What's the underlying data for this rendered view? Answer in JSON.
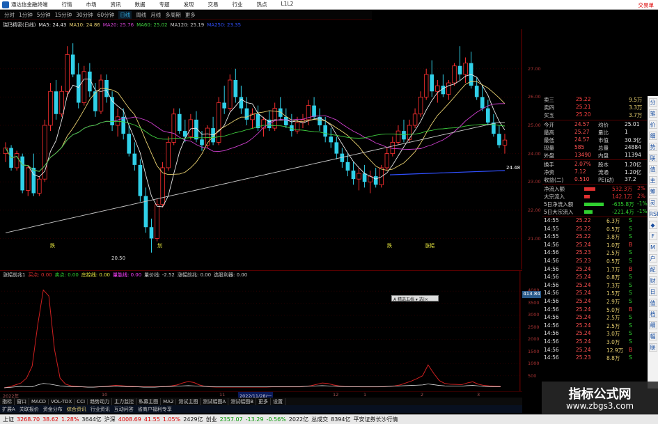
{
  "app": {
    "title": "通达信金融终端",
    "menu": [
      "行情",
      "市场",
      "资讯",
      "数据",
      "专题",
      "发现",
      "交易",
      "行业",
      "热点",
      "L1L2"
    ],
    "right_label": "交易单"
  },
  "period_tabs": {
    "items": [
      "分时",
      "1分钟",
      "5分钟",
      "15分钟",
      "30分钟",
      "60分钟",
      "日线",
      "周线",
      "月线",
      "多周期",
      "更多"
    ],
    "active": 6
  },
  "stock": {
    "name": "瑞玛精密(日线)"
  },
  "ma_legend": [
    {
      "label": "MA5: 24.43",
      "color": "#e8e8e8"
    },
    {
      "label": "MA10: 24.86",
      "color": "#e8d070"
    },
    {
      "label": "MA20: 25.76",
      "color": "#d040d0"
    },
    {
      "label": "MA60: 25.02",
      "color": "#40d040"
    },
    {
      "label": "MA120: 25.19",
      "color": "#c8c8c8"
    },
    {
      "label": "MA250: 23.35",
      "color": "#3050ff"
    }
  ],
  "indicator_legend": [
    {
      "label": "涨幅前兆1",
      "color": "#cccccc"
    },
    {
      "label": "买点: 0.00",
      "color": "#e03030"
    },
    {
      "label": "卖点: 0.00",
      "color": "#30d030"
    },
    {
      "label": "庄控线: 0.00",
      "color": "#e8e840"
    },
    {
      "label": "量能线: 0.00",
      "color": "#ff40ff"
    },
    {
      "label": "量价线: -2.52",
      "color": "#cccccc"
    },
    {
      "label": "涨幅前兆: 0.00",
      "color": "#cccccc"
    },
    {
      "label": "选股利器: 0.00",
      "color": "#cccccc"
    }
  ],
  "annotations": {
    "low_price": "20.50",
    "last_price": "24.48",
    "marks": [
      "跌",
      "划",
      "跌",
      "涨幅"
    ]
  },
  "y_axis_main": [
    "27.00",
    "26.00",
    "25.00",
    "24.00",
    "23.00",
    "22.00",
    "21.00"
  ],
  "y_axis_sub": [
    "4000",
    "3500",
    "3000",
    "2500",
    "2000",
    "1500",
    "1000",
    "500"
  ],
  "sub_price_tag": "413.84",
  "popup": "A 精选五档 ▾ 选|×",
  "time_axis": {
    "labels": [
      "2022年",
      "10",
      "11",
      "12",
      "2022/11/28/一",
      "1",
      "2",
      "3"
    ],
    "selected": 4
  },
  "bottom_tabs": [
    "指标",
    "窗口",
    "MACD",
    "VOL-TDX",
    "CCI",
    "趋势动力",
    "主力监控",
    "私募主图",
    "MA2",
    "测试主图",
    "测试幅图A",
    "测试幅图B",
    "更多",
    "设置"
  ],
  "news_tabs": [
    "扩展A",
    "关联报价",
    "资金分布",
    "综合资讯",
    "行业资讯",
    "互动问答",
    "省商户福利专享"
  ],
  "news_tabs_active": 3,
  "quote": {
    "book": [
      {
        "label": "卖三",
        "price": "25.22",
        "vol": "9.5万"
      },
      {
        "label": "卖四",
        "price": "25.21",
        "vol": "3.3万"
      },
      {
        "label": "买五",
        "price": "25.20",
        "vol": "3.7万"
      }
    ],
    "stats": [
      {
        "k1": "今开",
        "v1": "24.57",
        "k2": "均价",
        "v2": "25.01"
      },
      {
        "k1": "最高",
        "v1": "25.27",
        "k2": "量比",
        "v2": "1"
      },
      {
        "k1": "最低",
        "v1": "24.57",
        "k2": "市值",
        "v2": "30.3亿"
      },
      {
        "k1": "现量",
        "v1": "585",
        "k2": "总量",
        "v2": "24884"
      },
      {
        "k1": "外盘",
        "v1": "13490",
        "k2": "内盘",
        "v2": "11394"
      },
      {
        "k1": "换手",
        "v1": "2.07%",
        "k2": "股本",
        "v2": "1.20亿"
      },
      {
        "k1": "净资",
        "v1": "7.12",
        "k2": "流通",
        "v2": "1.20亿"
      },
      {
        "k1": "收益(二)",
        "v1": "0.510",
        "k2": "PE(动)",
        "v2": "37.2"
      }
    ],
    "flows": [
      {
        "label": "净流入额",
        "value": "532.3万",
        "pct": "2%",
        "color": "#e03030",
        "barlen": 8
      },
      {
        "label": "大宗流入",
        "value": "142.1万",
        "pct": "2%",
        "color": "#e03030",
        "barlen": 4
      },
      {
        "label": "5日净流入额",
        "value": "-635.8万",
        "pct": "-1%",
        "color": "#30d030",
        "barlen": 14
      },
      {
        "label": "5日大宗流入",
        "value": "-221.4万",
        "pct": "-1%",
        "color": "#30d030",
        "barlen": 6
      }
    ],
    "ticks": [
      {
        "time": "14:55",
        "price": "25.22",
        "vol": "6.3万",
        "side": "S"
      },
      {
        "time": "14:55",
        "price": "25.22",
        "vol": "0.5万",
        "side": "S"
      },
      {
        "time": "14:55",
        "price": "25.22",
        "vol": "3.8万",
        "side": "S"
      },
      {
        "time": "14:56",
        "price": "25.24",
        "vol": "1.0万",
        "side": "B"
      },
      {
        "time": "14:56",
        "price": "25.23",
        "vol": "2.5万",
        "side": "S"
      },
      {
        "time": "14:56",
        "price": "25.23",
        "vol": "0.5万",
        "side": "S"
      },
      {
        "time": "14:56",
        "price": "25.24",
        "vol": "1.7万",
        "side": "B"
      },
      {
        "time": "14:56",
        "price": "25.24",
        "vol": "0.8万",
        "side": "S"
      },
      {
        "time": "14:56",
        "price": "25.24",
        "vol": "7.3万",
        "side": "S"
      },
      {
        "time": "14:56",
        "price": "25.24",
        "vol": "1.5万",
        "side": "S"
      },
      {
        "time": "14:56",
        "price": "25.24",
        "vol": "2.9万",
        "side": "S"
      },
      {
        "time": "14:56",
        "price": "25.24",
        "vol": "5.0万",
        "side": "B"
      },
      {
        "time": "14:56",
        "price": "25.24",
        "vol": "2.5万",
        "side": "S"
      },
      {
        "time": "14:56",
        "price": "25.24",
        "vol": "2.5万",
        "side": "S"
      },
      {
        "time": "14:56",
        "price": "25.24",
        "vol": "3.0万",
        "side": "S"
      },
      {
        "time": "14:56",
        "price": "25.24",
        "vol": "3.0万",
        "side": "S"
      },
      {
        "time": "14:56",
        "price": "25.24",
        "vol": "12.9万",
        "side": "B"
      },
      {
        "time": "14:56",
        "price": "25.23",
        "vol": "8.8万",
        "side": "S"
      }
    ]
  },
  "side_toolbar": [
    "分",
    "笔",
    "价",
    "细",
    "势",
    "联",
    "值",
    "主",
    "筹",
    "灵",
    "RSI",
    "◆",
    "F",
    "M",
    "户",
    "配",
    "财",
    "日",
    "值",
    "档",
    "细",
    "幅",
    "联"
  ],
  "status": [
    {
      "text": "上证",
      "color": "#111"
    },
    {
      "text": "3268.70",
      "color": "#d00"
    },
    {
      "text": "38.62",
      "color": "#d00"
    },
    {
      "text": "1.28%",
      "color": "#d00"
    },
    {
      "text": "3644亿",
      "color": "#111"
    },
    {
      "text": "沪深",
      "color": "#111"
    },
    {
      "text": "4008.69",
      "color": "#d00"
    },
    {
      "text": "41.55",
      "color": "#d00"
    },
    {
      "text": "1.05%",
      "color": "#d00"
    },
    {
      "text": "2429亿",
      "color": "#111"
    },
    {
      "text": "创业",
      "color": "#111"
    },
    {
      "text": "2357.07",
      "color": "#090"
    },
    {
      "text": "-13.29",
      "color": "#090"
    },
    {
      "text": "-0.56%",
      "color": "#090"
    },
    {
      "text": "2022亿",
      "color": "#111"
    },
    {
      "text": "总成交",
      "color": "#111"
    },
    {
      "text": "8394亿",
      "color": "#111"
    },
    {
      "text": "平安证券长沙行情",
      "color": "#111"
    }
  ],
  "watermark": {
    "title": "指标公式网",
    "url": "www.zbgs3.com"
  },
  "colors": {
    "up": "#ff3030",
    "down": "#30d0e8",
    "ma5": "#e8e8e8",
    "ma10": "#e8d070",
    "ma20": "#d040d0",
    "ma60": "#40d040",
    "ma120": "#c8c8c8",
    "ma250": "#3050ff"
  },
  "chart_data": {
    "type": "candlestick",
    "note_series": "approximate daily OHLC read from chart",
    "ohlc": [
      [
        24.0,
        24.4,
        23.7,
        24.2
      ],
      [
        24.2,
        24.3,
        23.4,
        23.5
      ],
      [
        23.5,
        24.1,
        23.4,
        24.0
      ],
      [
        23.9,
        24.0,
        22.6,
        22.7
      ],
      [
        22.7,
        23.6,
        22.5,
        23.5
      ],
      [
        23.5,
        24.0,
        22.5,
        22.6
      ],
      [
        22.6,
        23.2,
        22.5,
        23.1
      ],
      [
        23.1,
        25.2,
        23.0,
        25.0
      ],
      [
        25.0,
        26.5,
        24.8,
        26.2
      ],
      [
        26.2,
        26.6,
        25.2,
        25.4
      ],
      [
        25.4,
        26.4,
        25.3,
        26.2
      ],
      [
        26.2,
        27.8,
        26.0,
        27.5
      ],
      [
        27.5,
        27.9,
        26.7,
        26.8
      ],
      [
        26.8,
        27.2,
        25.6,
        25.8
      ],
      [
        25.8,
        27.1,
        25.7,
        26.9
      ],
      [
        26.9,
        27.2,
        26.0,
        26.2
      ],
      [
        26.2,
        26.5,
        25.3,
        25.5
      ],
      [
        25.5,
        26.8,
        25.4,
        26.6
      ],
      [
        26.6,
        26.8,
        25.8,
        26.0
      ],
      [
        26.0,
        26.2,
        24.8,
        25.0
      ],
      [
        25.0,
        25.6,
        24.6,
        25.3
      ],
      [
        25.3,
        25.6,
        24.5,
        24.7
      ],
      [
        24.7,
        25.0,
        23.9,
        24.0
      ],
      [
        24.0,
        24.4,
        23.4,
        23.6
      ],
      [
        23.6,
        23.8,
        22.3,
        22.5
      ],
      [
        22.5,
        22.8,
        21.2,
        21.4
      ],
      [
        21.4,
        21.7,
        20.5,
        21.0
      ],
      [
        21.0,
        22.4,
        20.9,
        22.2
      ],
      [
        22.2,
        23.7,
        22.1,
        23.5
      ],
      [
        23.5,
        24.6,
        23.4,
        24.4
      ],
      [
        24.4,
        25.6,
        24.3,
        25.4
      ],
      [
        25.4,
        25.6,
        24.7,
        24.8
      ],
      [
        24.8,
        25.2,
        24.4,
        24.6
      ],
      [
        24.6,
        25.4,
        24.5,
        25.2
      ],
      [
        25.2,
        25.5,
        24.4,
        24.5
      ],
      [
        24.5,
        24.8,
        24.1,
        24.3
      ],
      [
        24.3,
        25.0,
        24.2,
        24.9
      ],
      [
        24.9,
        25.3,
        24.3,
        24.4
      ],
      [
        24.4,
        26.0,
        24.3,
        25.8
      ],
      [
        25.8,
        26.4,
        25.4,
        25.6
      ],
      [
        25.6,
        26.8,
        25.5,
        26.6
      ],
      [
        26.6,
        27.0,
        25.8,
        26.0
      ],
      [
        26.0,
        26.4,
        25.4,
        25.6
      ],
      [
        25.6,
        26.0,
        25.0,
        25.2
      ],
      [
        25.2,
        25.6,
        24.9,
        25.4
      ],
      [
        25.4,
        25.7,
        24.8,
        24.9
      ],
      [
        24.9,
        25.3,
        24.6,
        25.2
      ],
      [
        25.2,
        25.5,
        24.8,
        24.9
      ],
      [
        24.9,
        25.8,
        24.8,
        25.6
      ],
      [
        25.6,
        26.0,
        25.2,
        25.3
      ],
      [
        25.3,
        25.6,
        24.9,
        25.0
      ],
      [
        25.0,
        25.4,
        24.6,
        24.8
      ],
      [
        24.8,
        25.3,
        24.7,
        25.1
      ],
      [
        25.1,
        25.4,
        24.9,
        25.2
      ],
      [
        25.2,
        25.9,
        25.0,
        25.7
      ],
      [
        25.7,
        26.0,
        25.2,
        25.3
      ],
      [
        25.3,
        25.6,
        24.8,
        25.0
      ],
      [
        25.0,
        25.3,
        24.4,
        24.6
      ],
      [
        24.6,
        24.9,
        24.2,
        24.4
      ],
      [
        24.4,
        24.6,
        23.8,
        24.0
      ],
      [
        24.0,
        24.2,
        23.5,
        23.7
      ],
      [
        23.7,
        24.0,
        23.2,
        23.4
      ],
      [
        23.4,
        23.7,
        22.9,
        23.1
      ],
      [
        23.1,
        23.5,
        22.7,
        23.3
      ],
      [
        23.3,
        23.6,
        22.8,
        23.0
      ],
      [
        23.0,
        23.4,
        22.6,
        23.2
      ],
      [
        23.2,
        23.5,
        22.8,
        22.9
      ],
      [
        22.9,
        23.6,
        22.8,
        23.5
      ],
      [
        23.5,
        24.2,
        23.4,
        24.0
      ],
      [
        24.0,
        24.6,
        23.9,
        24.4
      ],
      [
        24.4,
        25.0,
        24.3,
        24.8
      ],
      [
        24.8,
        25.2,
        24.4,
        24.5
      ],
      [
        24.5,
        25.2,
        24.4,
        25.0
      ],
      [
        25.0,
        25.6,
        24.9,
        25.4
      ],
      [
        25.4,
        26.2,
        25.3,
        26.0
      ],
      [
        26.0,
        27.0,
        25.9,
        26.8
      ],
      [
        26.8,
        27.3,
        26.0,
        26.2
      ],
      [
        26.2,
        26.6,
        25.8,
        26.4
      ],
      [
        26.4,
        26.8,
        26.0,
        26.1
      ],
      [
        26.1,
        26.6,
        25.9,
        26.5
      ],
      [
        26.5,
        27.2,
        26.4,
        27.1
      ],
      [
        27.1,
        27.8,
        26.6,
        26.8
      ],
      [
        26.8,
        27.4,
        26.5,
        27.2
      ],
      [
        27.2,
        27.6,
        26.3,
        26.4
      ],
      [
        26.4,
        26.7,
        25.9,
        26.0
      ],
      [
        26.0,
        26.4,
        25.5,
        25.6
      ],
      [
        25.6,
        25.9,
        25.0,
        25.1
      ],
      [
        25.1,
        25.4,
        24.6,
        24.7
      ],
      [
        24.7,
        25.0,
        24.2,
        24.3
      ],
      [
        24.3,
        24.7,
        24.0,
        24.48
      ]
    ],
    "indicator": {
      "type": "line",
      "series": [
        {
          "name": "买点",
          "values": [
            0,
            50,
            120,
            200,
            400,
            900,
            2600,
            4050,
            3800,
            1600,
            400,
            150,
            80,
            60,
            40,
            30,
            30,
            40,
            60,
            80,
            100,
            90,
            70,
            60,
            50,
            40,
            40,
            40,
            50,
            60,
            80,
            120,
            200,
            260,
            220,
            120,
            60,
            40,
            30,
            30,
            30,
            30,
            30,
            30,
            30,
            30,
            30,
            30,
            40,
            40,
            40,
            40,
            40,
            40,
            60,
            90,
            140,
            200,
            180,
            120,
            80,
            60,
            50,
            50,
            40,
            40,
            40,
            40,
            50,
            60,
            80,
            120,
            200,
            280,
            380,
            500,
            950,
            600,
            300,
            180,
            150,
            140,
            130,
            200,
            250,
            150,
            100,
            80,
            70,
            60
          ]
        },
        {
          "name": "量价线",
          "values": [
            0,
            20,
            40,
            60,
            50,
            40,
            120,
            180,
            160,
            120,
            80,
            60,
            50,
            40,
            40,
            30,
            30,
            40,
            50,
            60,
            70,
            60,
            50,
            40,
            40,
            30,
            30,
            30,
            40,
            50,
            60,
            70,
            80,
            90,
            80,
            70,
            60,
            50,
            40,
            40,
            40,
            40,
            40,
            40,
            40,
            40,
            40,
            40,
            50,
            50,
            50,
            50,
            50,
            50,
            60,
            70,
            80,
            90,
            80,
            70,
            60,
            50,
            50,
            50,
            40,
            40,
            40,
            40,
            50,
            60,
            70,
            80,
            90,
            100,
            110,
            120,
            160,
            130,
            100,
            80,
            70,
            70,
            70,
            90,
            100,
            80,
            60,
            50,
            40,
            40
          ]
        }
      ],
      "ylim": [
        0,
        4500
      ]
    }
  }
}
